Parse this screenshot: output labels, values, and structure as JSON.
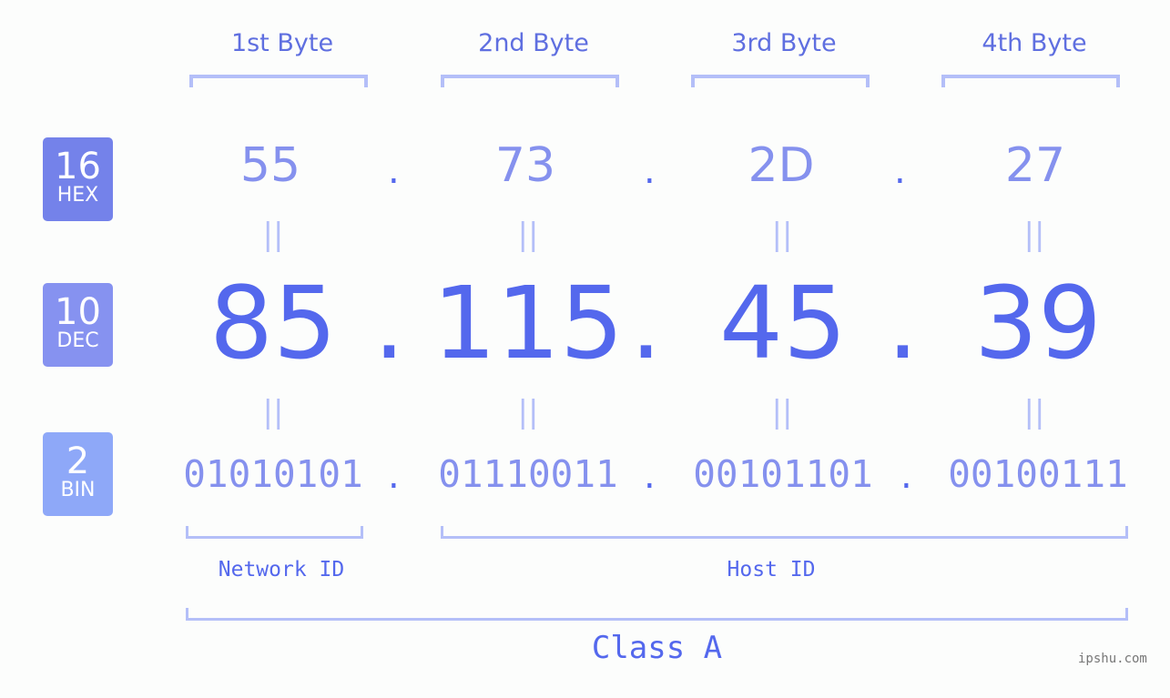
{
  "badges": [
    {
      "number": "16",
      "label": "HEX",
      "color": "#7482ea"
    },
    {
      "number": "10",
      "label": "DEC",
      "color": "#8692f0"
    },
    {
      "number": "2",
      "label": "BIN",
      "color": "#8ea8f8"
    }
  ],
  "bytes": [
    {
      "header": "1st Byte",
      "hex": "55",
      "dec": "85",
      "bin": "01010101"
    },
    {
      "header": "2nd Byte",
      "hex": "73",
      "dec": "115",
      "bin": "01110011"
    },
    {
      "header": "3rd Byte",
      "hex": "2D",
      "dec": "45",
      "bin": "00101101"
    },
    {
      "header": "4th Byte",
      "hex": "27",
      "dec": "39",
      "bin": "00100111"
    }
  ],
  "separator": ".",
  "equals": "||",
  "network_id_label": "Network ID",
  "host_id_label": "Host ID",
  "class_label": "Class A",
  "watermark": "ipshu.com",
  "colors": {
    "accent": "#5468ed",
    "light": "#b4bff8",
    "mid": "#8591ee"
  }
}
